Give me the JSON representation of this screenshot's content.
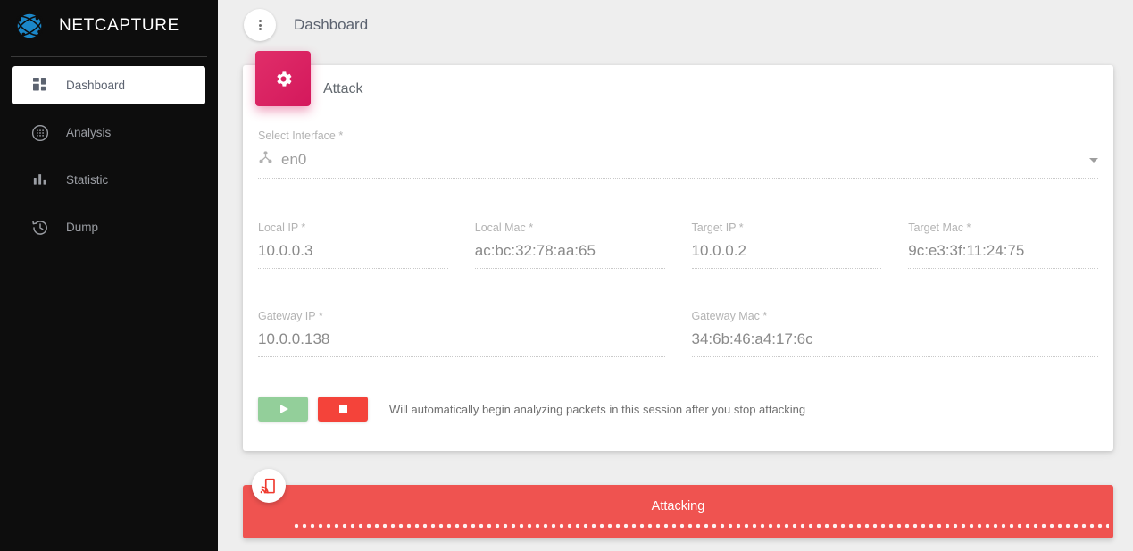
{
  "brand": {
    "name": "NETCAPTURE",
    "logo_icon": "network-globe-icon",
    "logo_color": "#1b87c9"
  },
  "sidebar": {
    "items": [
      {
        "label": "Dashboard",
        "icon": "dashboard-grid-icon",
        "active": true
      },
      {
        "label": "Analysis",
        "icon": "analysis-globe-icon",
        "active": false
      },
      {
        "label": "Statistic",
        "icon": "bar-chart-icon",
        "active": false
      },
      {
        "label": "Dump",
        "icon": "history-clock-icon",
        "active": false
      }
    ]
  },
  "topbar": {
    "menu_icon": "kebab-menu-icon",
    "title": "Dashboard"
  },
  "card": {
    "badge_icon": "gear-icon",
    "badge_color": "#d81b60",
    "title": "Attack",
    "interface_field": {
      "label": "Select Interface *",
      "value": "en0",
      "icon": "device-hub-icon",
      "caret_icon": "chevron-down-icon"
    },
    "fields_row1": [
      {
        "label": "Local IP *",
        "value": "10.0.0.3"
      },
      {
        "label": "Local Mac *",
        "value": "ac:bc:32:78:aa:65"
      },
      {
        "label": "Target IP *",
        "value": "10.0.0.2"
      },
      {
        "label": "Target Mac *",
        "value": "9c:e3:3f:11:24:75"
      }
    ],
    "fields_row2": [
      {
        "label": "Gateway IP *",
        "value": "10.0.0.138"
      },
      {
        "label": "Gateway Mac *",
        "value": "34:6b:46:a4:17:6c"
      }
    ],
    "actions": {
      "play_icon": "play-icon",
      "play_color": "#93cf9a",
      "stop_icon": "stop-icon",
      "stop_color": "#f4433a",
      "hint": "Will automatically begin analyzing packets in this session after you stop attacking"
    }
  },
  "banner": {
    "status": "Attacking",
    "color": "#ef5350",
    "badge_icon": "wireless-device-icon",
    "progress_style": "indeterminate-dotted"
  }
}
